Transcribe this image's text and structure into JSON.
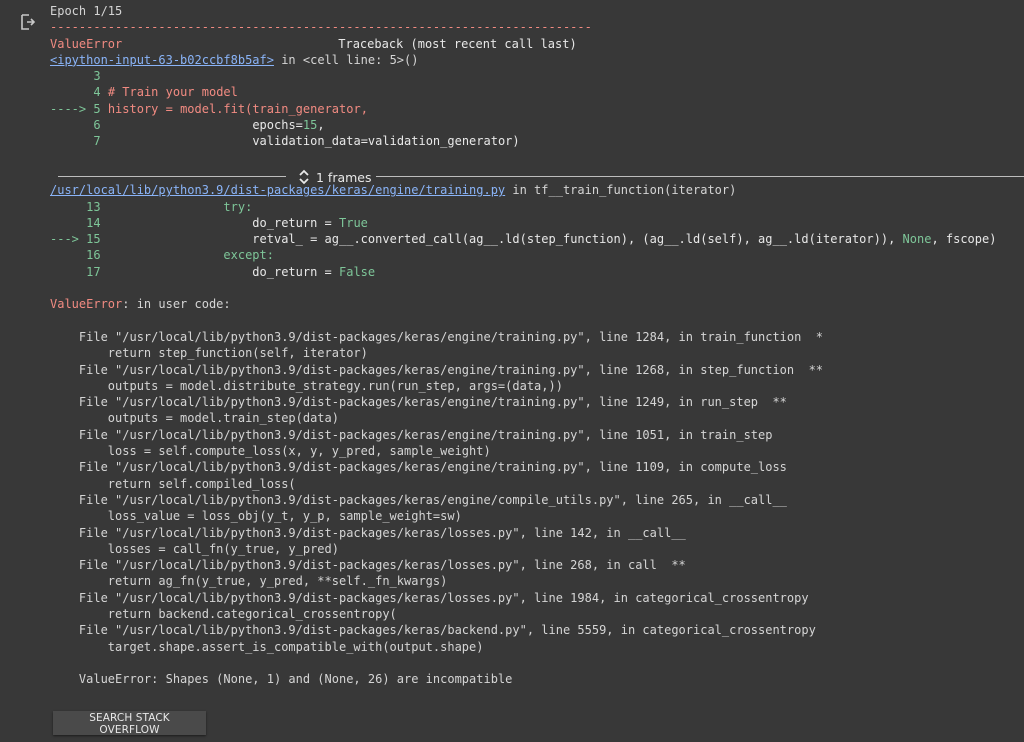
{
  "output_icon": "output-redirect-icon",
  "epoch": "Epoch 1/15",
  "separator": "---------------------------------------------------------------------------",
  "error_name": "ValueError",
  "traceback_header": "Traceback (most recent call last)",
  "cell_link": "<ipython-input-63-b02ccbf8b5af>",
  "cell_loc": " in <cell line: 5>()",
  "code1": [
    {
      "arrow": "      ",
      "no": "3",
      "text": ""
    },
    {
      "arrow": "      ",
      "no": "4",
      "text": "# Train your model"
    },
    {
      "arrow": "----> ",
      "no": "5",
      "text": "history = model.fit(train_generator,"
    },
    {
      "arrow": "      ",
      "no": "6",
      "text": "                    epochs=15,"
    },
    {
      "arrow": "      ",
      "no": "7",
      "text": "                    validation_data=validation_generator)"
    }
  ],
  "frames_label": "1 frames",
  "frames_icon": "unfold-arrows-icon",
  "file_link": "/usr/local/lib/python3.9/dist-packages/keras/engine/training.py",
  "file_loc": " in tf__train_function(iterator)",
  "code2": [
    {
      "arrow": "     ",
      "no": "13",
      "text": "                try:"
    },
    {
      "arrow": "     ",
      "no": "14",
      "text": "                    do_return = True"
    },
    {
      "arrow": "---> ",
      "no": "15",
      "text": "                    retval_ = ag__.converted_call(ag__.ld(step_function), (ag__.ld(self), ag__.ld(iterator)), None, fscope)"
    },
    {
      "arrow": "     ",
      "no": "16",
      "text": "                except:"
    },
    {
      "arrow": "     ",
      "no": "17",
      "text": "                    do_return = False"
    }
  ],
  "error_msg": ": in user code:",
  "trace_lines": [
    "    File \"/usr/local/lib/python3.9/dist-packages/keras/engine/training.py\", line 1284, in train_function  *",
    "        return step_function(self, iterator)",
    "    File \"/usr/local/lib/python3.9/dist-packages/keras/engine/training.py\", line 1268, in step_function  **",
    "        outputs = model.distribute_strategy.run(run_step, args=(data,))",
    "    File \"/usr/local/lib/python3.9/dist-packages/keras/engine/training.py\", line 1249, in run_step  **",
    "        outputs = model.train_step(data)",
    "    File \"/usr/local/lib/python3.9/dist-packages/keras/engine/training.py\", line 1051, in train_step",
    "        loss = self.compute_loss(x, y, y_pred, sample_weight)",
    "    File \"/usr/local/lib/python3.9/dist-packages/keras/engine/training.py\", line 1109, in compute_loss",
    "        return self.compiled_loss(",
    "    File \"/usr/local/lib/python3.9/dist-packages/keras/engine/compile_utils.py\", line 265, in __call__",
    "        loss_value = loss_obj(y_t, y_p, sample_weight=sw)",
    "    File \"/usr/local/lib/python3.9/dist-packages/keras/losses.py\", line 142, in __call__",
    "        losses = call_fn(y_true, y_pred)",
    "    File \"/usr/local/lib/python3.9/dist-packages/keras/losses.py\", line 268, in call  **",
    "        return ag_fn(y_true, y_pred, **self._fn_kwargs)",
    "    File \"/usr/local/lib/python3.9/dist-packages/keras/losses.py\", line 1984, in categorical_crossentropy",
    "        return backend.categorical_crossentropy(",
    "    File \"/usr/local/lib/python3.9/dist-packages/keras/backend.py\", line 5559, in categorical_crossentropy",
    "        target.shape.assert_is_compatible_with(output.shape)",
    "",
    "    ValueError: Shapes (None, 1) and (None, 26) are incompatible"
  ],
  "search_button": "SEARCH STACK OVERFLOW",
  "colors": {
    "background": "#383838",
    "error": "#f28b82",
    "line_number": "#7ec699",
    "link": "#8ab4f8"
  }
}
